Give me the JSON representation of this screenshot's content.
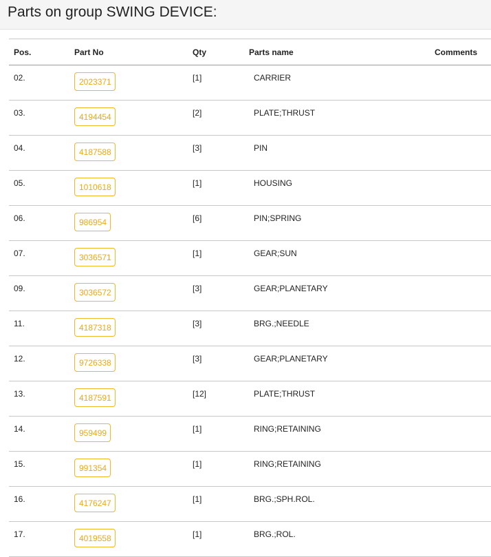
{
  "page": {
    "title": "Parts on group SWING DEVICE:"
  },
  "table": {
    "headers": {
      "pos": "Pos.",
      "part_no": "Part No",
      "qty": "Qty",
      "parts_name": "Parts name",
      "comments": "Comments"
    },
    "rows": [
      {
        "pos": "02.",
        "part_no": "2023371",
        "qty": "[1]",
        "name": "CARRIER",
        "comments": ""
      },
      {
        "pos": "03.",
        "part_no": "4194454",
        "qty": "[2]",
        "name": "PLATE;THRUST",
        "comments": ""
      },
      {
        "pos": "04.",
        "part_no": "4187588",
        "qty": "[3]",
        "name": "PIN",
        "comments": ""
      },
      {
        "pos": "05.",
        "part_no": "1010618",
        "qty": "[1]",
        "name": "HOUSING",
        "comments": ""
      },
      {
        "pos": "06.",
        "part_no": "986954",
        "qty": "[6]",
        "name": "PIN;SPRING",
        "comments": ""
      },
      {
        "pos": "07.",
        "part_no": "3036571",
        "qty": "[1]",
        "name": "GEAR;SUN",
        "comments": ""
      },
      {
        "pos": "09.",
        "part_no": "3036572",
        "qty": "[3]",
        "name": "GEAR;PLANETARY",
        "comments": ""
      },
      {
        "pos": "11.",
        "part_no": "4187318",
        "qty": "[3]",
        "name": "BRG.;NEEDLE",
        "comments": ""
      },
      {
        "pos": "12.",
        "part_no": "9726338",
        "qty": "[3]",
        "name": "GEAR;PLANETARY",
        "comments": ""
      },
      {
        "pos": "13.",
        "part_no": "4187591",
        "qty": "[12]",
        "name": "PLATE;THRUST",
        "comments": ""
      },
      {
        "pos": "14.",
        "part_no": "959499",
        "qty": "[1]",
        "name": "RING;RETAINING",
        "comments": ""
      },
      {
        "pos": "15.",
        "part_no": "991354",
        "qty": "[1]",
        "name": "RING;RETAINING",
        "comments": ""
      },
      {
        "pos": "16.",
        "part_no": "4176247",
        "qty": "[1]",
        "name": "BRG.;SPH.ROL.",
        "comments": ""
      },
      {
        "pos": "17.",
        "part_no": "4019558",
        "qty": "[1]",
        "name": "BRG.;ROL.",
        "comments": ""
      }
    ]
  },
  "colors": {
    "part_link": "#e9a91a",
    "part_border": "#f0b72a",
    "header_bg": "#f5f5f5"
  }
}
